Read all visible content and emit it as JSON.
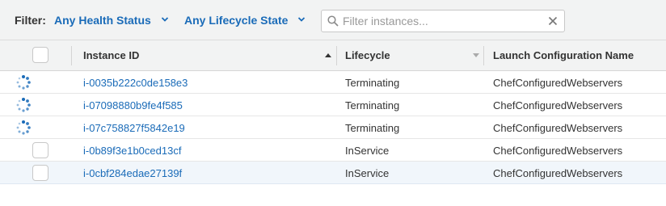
{
  "filter": {
    "label": "Filter:",
    "health_status": "Any Health Status",
    "lifecycle_state": "Any Lifecycle State",
    "search_placeholder": "Filter instances...",
    "search_value": ""
  },
  "table": {
    "columns": [
      "Instance ID",
      "Lifecycle",
      "Launch Configuration Name"
    ],
    "sort_column": "Instance ID",
    "sort_direction": "ascending",
    "rows": [
      {
        "instance_id": "i-0035b222c0de158e3",
        "lifecycle": "Terminating",
        "launch_config": "ChefConfiguredWebservers",
        "status_icon": "loading-spinner"
      },
      {
        "instance_id": "i-07098880b9fe4f585",
        "lifecycle": "Terminating",
        "launch_config": "ChefConfiguredWebservers",
        "status_icon": "loading-spinner"
      },
      {
        "instance_id": "i-07c758827f5842e19",
        "lifecycle": "Terminating",
        "launch_config": "ChefConfiguredWebservers",
        "status_icon": "loading-spinner"
      },
      {
        "instance_id": "i-0b89f3e1b0ced13cf",
        "lifecycle": "InService",
        "launch_config": "ChefConfiguredWebservers",
        "status_icon": "checkbox"
      },
      {
        "instance_id": "i-0cbf284edae27139f",
        "lifecycle": "InService",
        "launch_config": "ChefConfiguredWebservers",
        "status_icon": "checkbox"
      }
    ]
  },
  "colors": {
    "link": "#1a6bb8",
    "header_bg": "#f2f3f3",
    "highlight_row": "#f1f6fb",
    "spinner": "#1a6bb8"
  }
}
